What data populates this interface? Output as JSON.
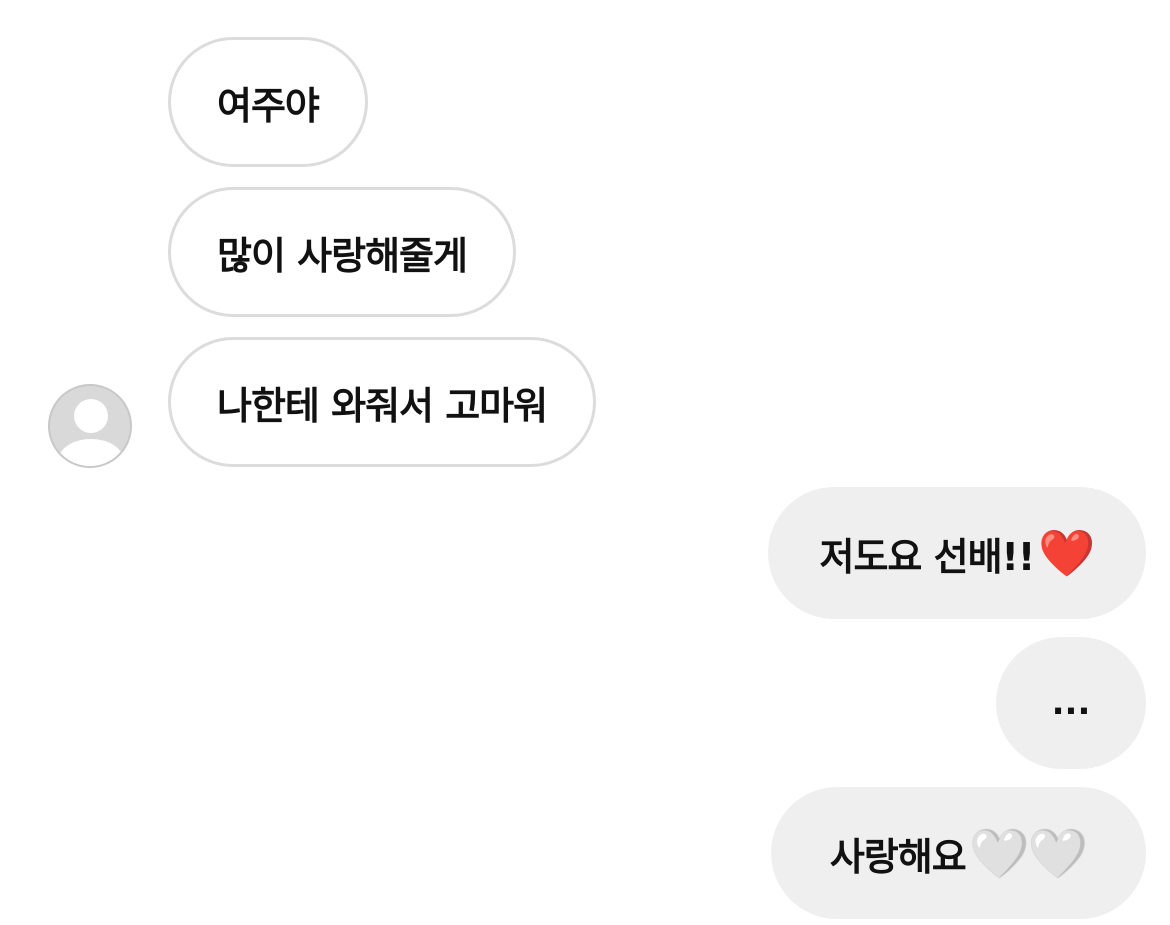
{
  "received": [
    {
      "text": "여주야"
    },
    {
      "text": "많이 사랑해줄게"
    },
    {
      "text": "나한테 와줘서 고마워"
    }
  ],
  "sent": [
    {
      "text": "저도요 선배!!",
      "emoji": "❤️"
    },
    {
      "text": "..."
    },
    {
      "text": "사랑해요 ",
      "emoji": "🤍🤍"
    }
  ],
  "icons": {
    "avatar": "default-profile-icon",
    "red_heart": "red-heart-emoji",
    "white_heart": "white-heart-emoji"
  },
  "colors": {
    "received_bubble_border": "#dcdcdc",
    "sent_bubble_background": "#efefef",
    "text": "#111111"
  }
}
